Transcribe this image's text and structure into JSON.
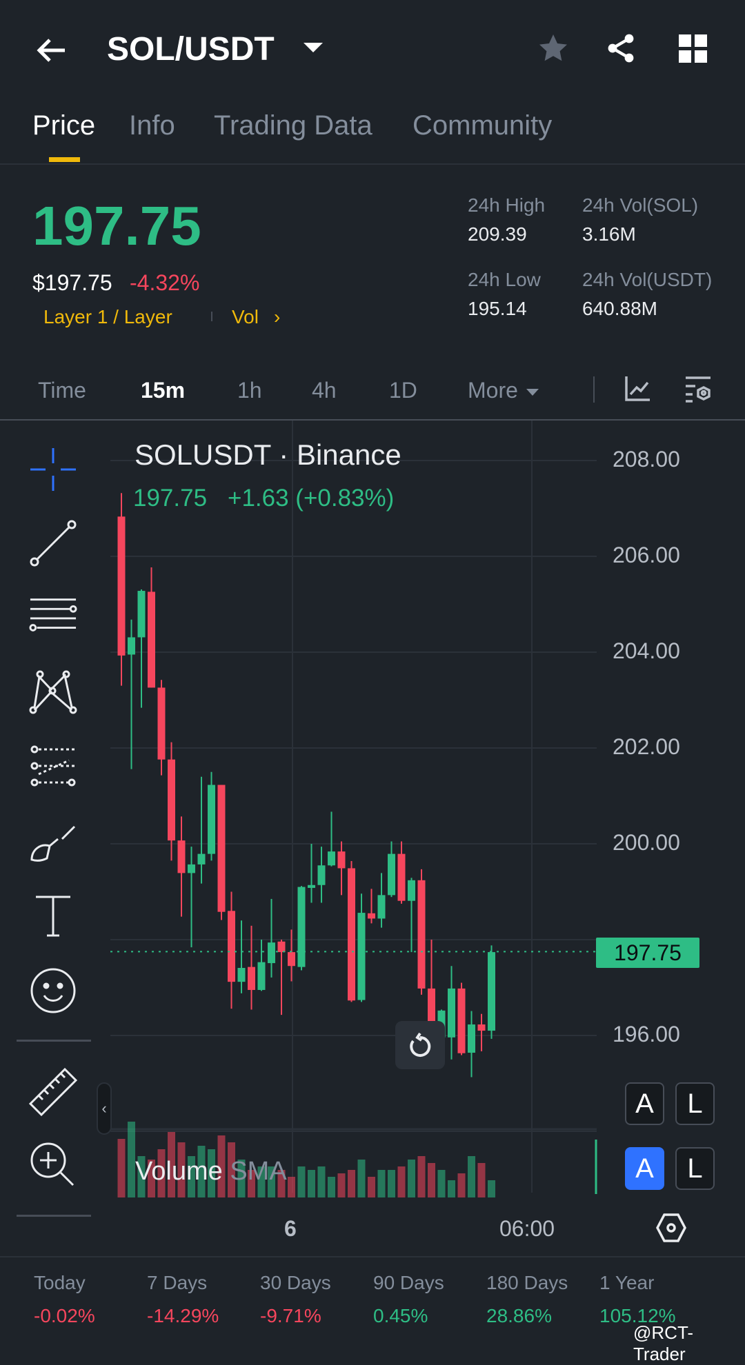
{
  "header": {
    "title": "SOL/USDT"
  },
  "tabs": [
    "Price",
    "Info",
    "Trading Data",
    "Community"
  ],
  "price": {
    "last": "197.75",
    "usd": "$197.75",
    "change": "-4.32%",
    "tag": "Layer 1 / Layer",
    "vol_link": "Vol"
  },
  "stats": {
    "high_label": "24h High",
    "high": "209.39",
    "low_label": "24h Low",
    "low": "195.14",
    "vol_sol_label": "24h Vol(SOL)",
    "vol_sol": "3.16M",
    "vol_usdt_label": "24h Vol(USDT)",
    "vol_usdt": "640.88M"
  },
  "timeframes": [
    "Time",
    "15m",
    "1h",
    "4h",
    "1D",
    "More"
  ],
  "chart": {
    "symbol": "SOLUSDT · Binance",
    "ohlc_last": "197.75",
    "ohlc_change": "+1.63 (+0.83%)",
    "volume_label": "Volume",
    "sma_label": "SMA",
    "current_price_label": "197.75",
    "auto": "A",
    "log": "L"
  },
  "chart_data": {
    "type": "candlestick",
    "y_ticks": [
      "208.00",
      "206.00",
      "204.00",
      "202.00",
      "200.00",
      "196.00"
    ],
    "ylim": [
      194.5,
      208.5
    ],
    "x_ticks": [
      "6",
      "06:00"
    ],
    "current_price": 197.75,
    "candles": [
      [
        206.83,
        207.32,
        203.3,
        203.93
      ],
      [
        203.95,
        204.68,
        201.56,
        204.31
      ],
      [
        204.31,
        205.31,
        202.84,
        205.28
      ],
      [
        205.26,
        205.77,
        203.26,
        203.26
      ],
      [
        203.26,
        203.42,
        201.43,
        201.76
      ],
      [
        201.76,
        202.12,
        199.65,
        200.07
      ],
      [
        200.07,
        200.57,
        198.48,
        199.39
      ],
      [
        199.39,
        199.94,
        197.84,
        199.57
      ],
      [
        199.57,
        201.4,
        199.17,
        199.79
      ],
      [
        199.79,
        201.5,
        199.65,
        201.23
      ],
      [
        201.23,
        201.23,
        198.41,
        198.58
      ],
      [
        198.6,
        199.0,
        196.56,
        197.12
      ],
      [
        197.12,
        198.4,
        196.88,
        197.41
      ],
      [
        197.43,
        198.29,
        196.54,
        196.95
      ],
      [
        196.95,
        198.0,
        196.93,
        197.53
      ],
      [
        197.51,
        198.85,
        197.21,
        197.94
      ],
      [
        197.96,
        198.0,
        196.43,
        197.74
      ],
      [
        197.74,
        198.21,
        197.13,
        197.45
      ],
      [
        197.43,
        199.12,
        197.36,
        199.1
      ],
      [
        199.08,
        200.0,
        198.77,
        199.14
      ],
      [
        199.14,
        199.94,
        198.77,
        199.55
      ],
      [
        199.55,
        200.67,
        199.53,
        199.84
      ],
      [
        199.84,
        200.05,
        198.93,
        199.49
      ],
      [
        199.49,
        199.64,
        196.7,
        196.73
      ],
      [
        196.74,
        198.96,
        196.7,
        198.56
      ],
      [
        198.55,
        199.06,
        198.34,
        198.44
      ],
      [
        198.44,
        199.39,
        198.25,
        198.93
      ],
      [
        198.93,
        200.05,
        198.89,
        199.79
      ],
      [
        199.79,
        200.05,
        198.75,
        198.81
      ],
      [
        198.81,
        199.29,
        197.74,
        199.24
      ],
      [
        199.24,
        199.47,
        196.85,
        196.98
      ],
      [
        196.98,
        198.0,
        196.2,
        196.29
      ],
      [
        195.96,
        196.54,
        195.67,
        196.52
      ],
      [
        195.96,
        197.45,
        195.5,
        196.98
      ],
      [
        196.98,
        197.1,
        195.59,
        195.63
      ],
      [
        195.64,
        196.51,
        195.13,
        196.23
      ],
      [
        196.23,
        196.45,
        195.67,
        196.1
      ],
      [
        196.1,
        197.88,
        195.93,
        197.74
      ]
    ],
    "volume": [
      85,
      110,
      60,
      55,
      70,
      95,
      80,
      60,
      75,
      70,
      90,
      80,
      55,
      40,
      45,
      45,
      40,
      30,
      45,
      40,
      45,
      30,
      35,
      40,
      55,
      30,
      40,
      40,
      45,
      55,
      60,
      50,
      40,
      25,
      35,
      60,
      50,
      25
    ]
  },
  "performance": [
    {
      "label": "Today",
      "value": "-0.02%"
    },
    {
      "label": "7 Days",
      "value": "-14.29%"
    },
    {
      "label": "30 Days",
      "value": "-9.71%"
    },
    {
      "label": "90 Days",
      "value": "0.45%"
    },
    {
      "label": "180 Days",
      "value": "28.86%"
    },
    {
      "label": "1 Year",
      "value": "105.12%"
    }
  ],
  "watermark": "@RCT-Trader",
  "colors": {
    "up": "#2ebd85",
    "down": "#f6465d",
    "accent": "#f0b90b",
    "bg": "#1e2329"
  }
}
